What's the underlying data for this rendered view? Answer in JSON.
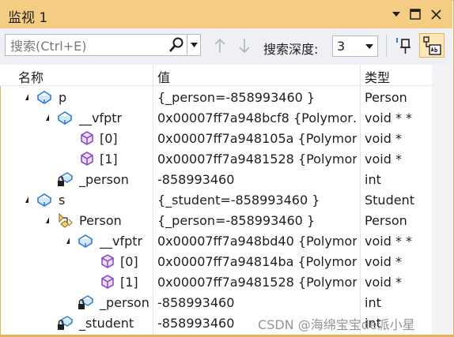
{
  "window": {
    "title": "监视 1"
  },
  "toolbar": {
    "search_placeholder": "搜索(Ctrl+E)",
    "depth_label": "搜索深度:",
    "depth_value": "3"
  },
  "columns": {
    "name": "名称",
    "value": "值",
    "type": "类型"
  },
  "rows": [
    {
      "name": "p",
      "value": "{_person=-858993460 }",
      "type": "Person",
      "icon": "object-icon",
      "expanded": true
    },
    {
      "name": "__vfptr",
      "value": "0x00007ff7a948bcf8 {Polymor…",
      "type": "void * *",
      "icon": "object-icon",
      "expanded": true
    },
    {
      "name": "[0]",
      "value": "0x00007ff7a948105a {Polymor…",
      "type": "void *",
      "icon": "cube-icon"
    },
    {
      "name": "[1]",
      "value": "0x00007ff7a9481528 {Polymor…",
      "type": "void *",
      "icon": "cube-icon"
    },
    {
      "name": "_person",
      "value": "-858993460",
      "type": "int",
      "icon": "private-field-icon"
    },
    {
      "name": "s",
      "value": "{_student=-858993460 }",
      "type": "Student",
      "icon": "object-icon",
      "expanded": true
    },
    {
      "name": "Person",
      "value": "{_person=-858993460 }",
      "type": "Person",
      "icon": "base-class-icon",
      "expanded": true
    },
    {
      "name": "__vfptr",
      "value": "0x00007ff7a948bd40 {Polymor…",
      "type": "void * *",
      "icon": "object-icon",
      "expanded": true
    },
    {
      "name": "[0]",
      "value": "0x00007ff7a94814ba {Polymor…",
      "type": "void *",
      "icon": "cube-icon"
    },
    {
      "name": "[1]",
      "value": "0x00007ff7a9481528 {Polymor…",
      "type": "void *",
      "icon": "cube-icon"
    },
    {
      "name": "_person",
      "value": "-858993460",
      "type": "int",
      "icon": "private-field-icon"
    },
    {
      "name": "_student",
      "value": "-858993460",
      "type": "int",
      "icon": "private-field-icon"
    }
  ],
  "watermark": "CSDN @海绵宝宝de派小星",
  "colors": {
    "titlebar": "#f5cc84",
    "accent": "#e3b55a",
    "object_icon": "#2f7fd4",
    "cube_icon": "#8a4fc6"
  }
}
